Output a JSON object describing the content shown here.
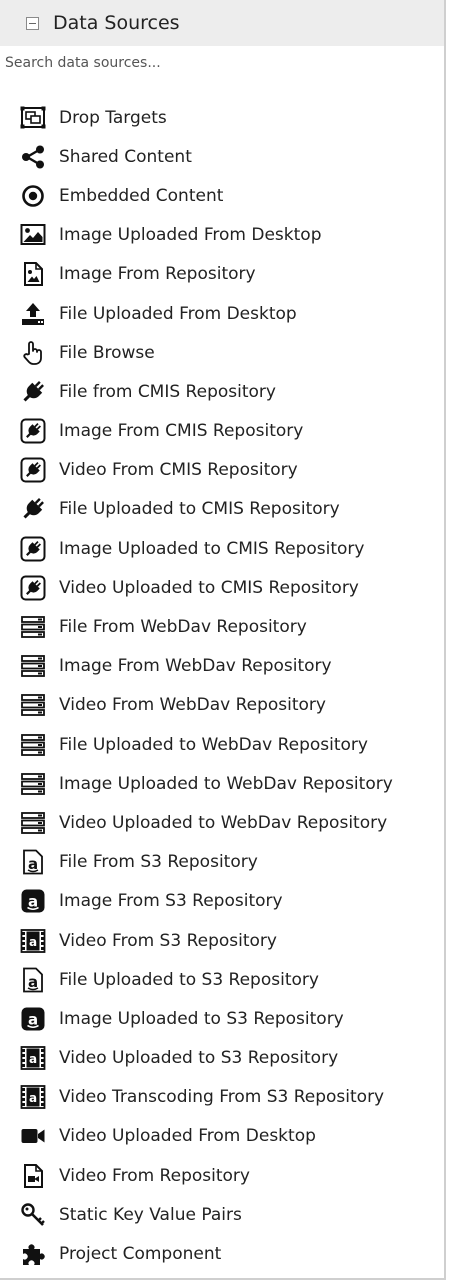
{
  "panel": {
    "title": "Data Sources",
    "search_placeholder": "Search data sources..."
  },
  "items": [
    {
      "label": "Drop Targets",
      "icon": "drop-target-icon"
    },
    {
      "label": "Shared Content",
      "icon": "share-icon"
    },
    {
      "label": "Embedded Content",
      "icon": "dot-circle-icon"
    },
    {
      "label": "Image Uploaded From Desktop",
      "icon": "image-icon"
    },
    {
      "label": "Image From Repository",
      "icon": "file-image-icon"
    },
    {
      "label": "File Uploaded From Desktop",
      "icon": "upload-icon"
    },
    {
      "label": "File Browse",
      "icon": "hand-pointer-icon"
    },
    {
      "label": "File from CMIS Repository",
      "icon": "plug-icon"
    },
    {
      "label": "Image From CMIS Repository",
      "icon": "plug-square-icon"
    },
    {
      "label": "Video From CMIS Repository",
      "icon": "plug-square-icon"
    },
    {
      "label": "File Uploaded to CMIS Repository",
      "icon": "plug-icon"
    },
    {
      "label": "Image Uploaded to CMIS Repository",
      "icon": "plug-square-icon"
    },
    {
      "label": "Video Uploaded to CMIS Repository",
      "icon": "plug-square-icon"
    },
    {
      "label": "File From WebDav Repository",
      "icon": "server-icon"
    },
    {
      "label": "Image From WebDav Repository",
      "icon": "server-icon"
    },
    {
      "label": "Video From WebDav Repository",
      "icon": "server-icon"
    },
    {
      "label": "File Uploaded to WebDav Repository",
      "icon": "server-icon"
    },
    {
      "label": "Image Uploaded to WebDav Repository",
      "icon": "server-icon"
    },
    {
      "label": "Video Uploaded to WebDav Repository",
      "icon": "server-icon"
    },
    {
      "label": "File From S3 Repository",
      "icon": "amazon-file-icon"
    },
    {
      "label": "Image From S3 Repository",
      "icon": "amazon-square-icon"
    },
    {
      "label": "Video From S3 Repository",
      "icon": "amazon-film-icon"
    },
    {
      "label": "File Uploaded to S3 Repository",
      "icon": "amazon-file-icon"
    },
    {
      "label": "Image Uploaded to S3 Repository",
      "icon": "amazon-square-icon"
    },
    {
      "label": "Video Uploaded to S3 Repository",
      "icon": "amazon-film-icon"
    },
    {
      "label": "Video Transcoding From S3 Repository",
      "icon": "amazon-film-icon"
    },
    {
      "label": "Video Uploaded From Desktop",
      "icon": "video-camera-icon"
    },
    {
      "label": "Video From Repository",
      "icon": "file-video-icon"
    },
    {
      "label": "Static Key Value Pairs",
      "icon": "key-icon"
    },
    {
      "label": "Project Component",
      "icon": "puzzle-icon"
    }
  ]
}
